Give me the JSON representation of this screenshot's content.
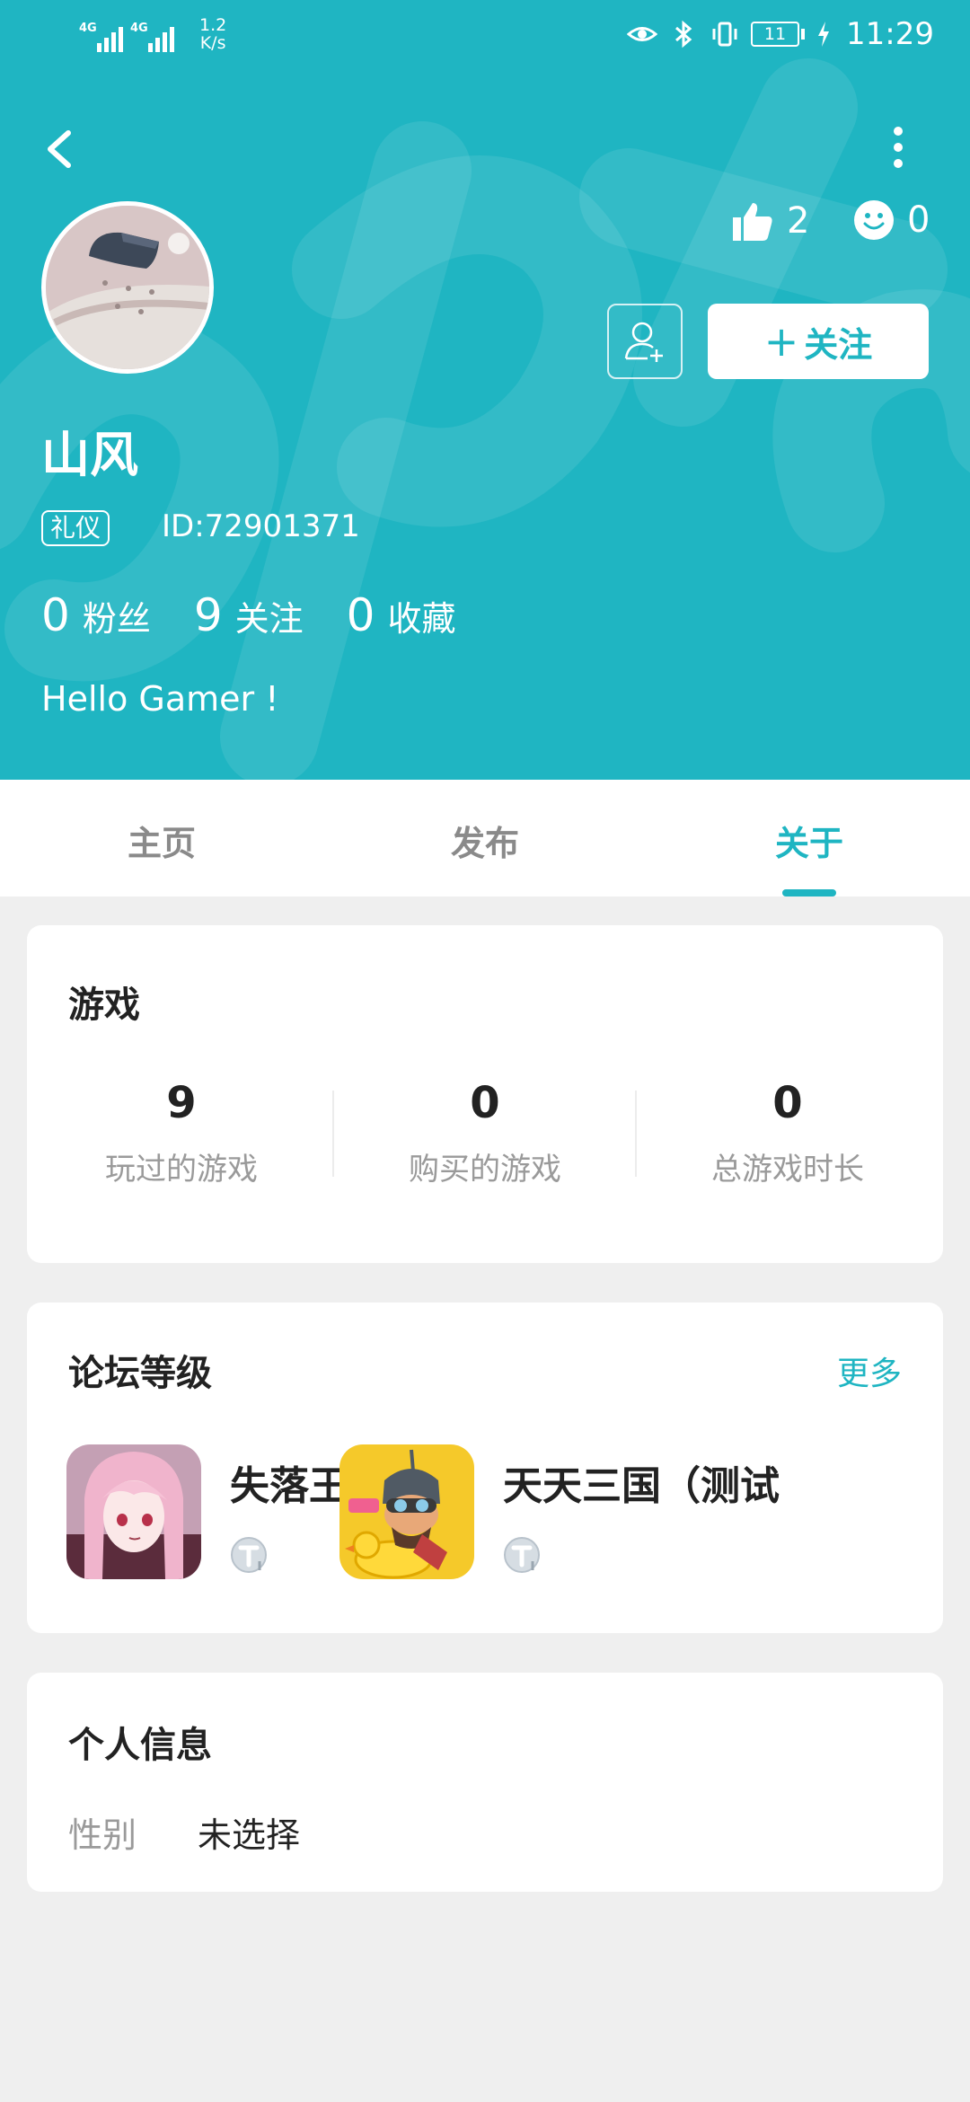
{
  "status_bar": {
    "net1": "4G",
    "net2": "4G",
    "speed_value": "1.2",
    "speed_unit": "K/s",
    "battery": "11",
    "time": "11:29"
  },
  "profile": {
    "likes": "2",
    "smiles": "0",
    "follow_label": "关注",
    "username": "山风",
    "badge": "礼仪",
    "user_id": "ID:72901371",
    "counts": [
      {
        "num": "0",
        "label": "粉丝"
      },
      {
        "num": "9",
        "label": "关注"
      },
      {
        "num": "0",
        "label": "收藏"
      }
    ],
    "bio": "Hello Gamer !"
  },
  "tabs": [
    {
      "label": "主页",
      "active": false
    },
    {
      "label": "发布",
      "active": false
    },
    {
      "label": "关于",
      "active": true
    }
  ],
  "games_card": {
    "title": "游戏",
    "stats": [
      {
        "value": "9",
        "label": "玩过的游戏"
      },
      {
        "value": "0",
        "label": "购买的游戏"
      },
      {
        "value": "0",
        "label": "总游戏时长"
      }
    ]
  },
  "forum_card": {
    "title": "论坛等级",
    "more": "更多",
    "games": [
      {
        "name": "失落王冠",
        "level_icon": "level-t1-badge"
      },
      {
        "name": "天天三国（测试",
        "level_icon": "level-t1-badge"
      }
    ]
  },
  "info_card": {
    "title": "个人信息",
    "rows": [
      {
        "key": "性别",
        "value": "未选择"
      }
    ]
  },
  "colors": {
    "accent": "#1fb5c2",
    "background": "#efefef"
  }
}
